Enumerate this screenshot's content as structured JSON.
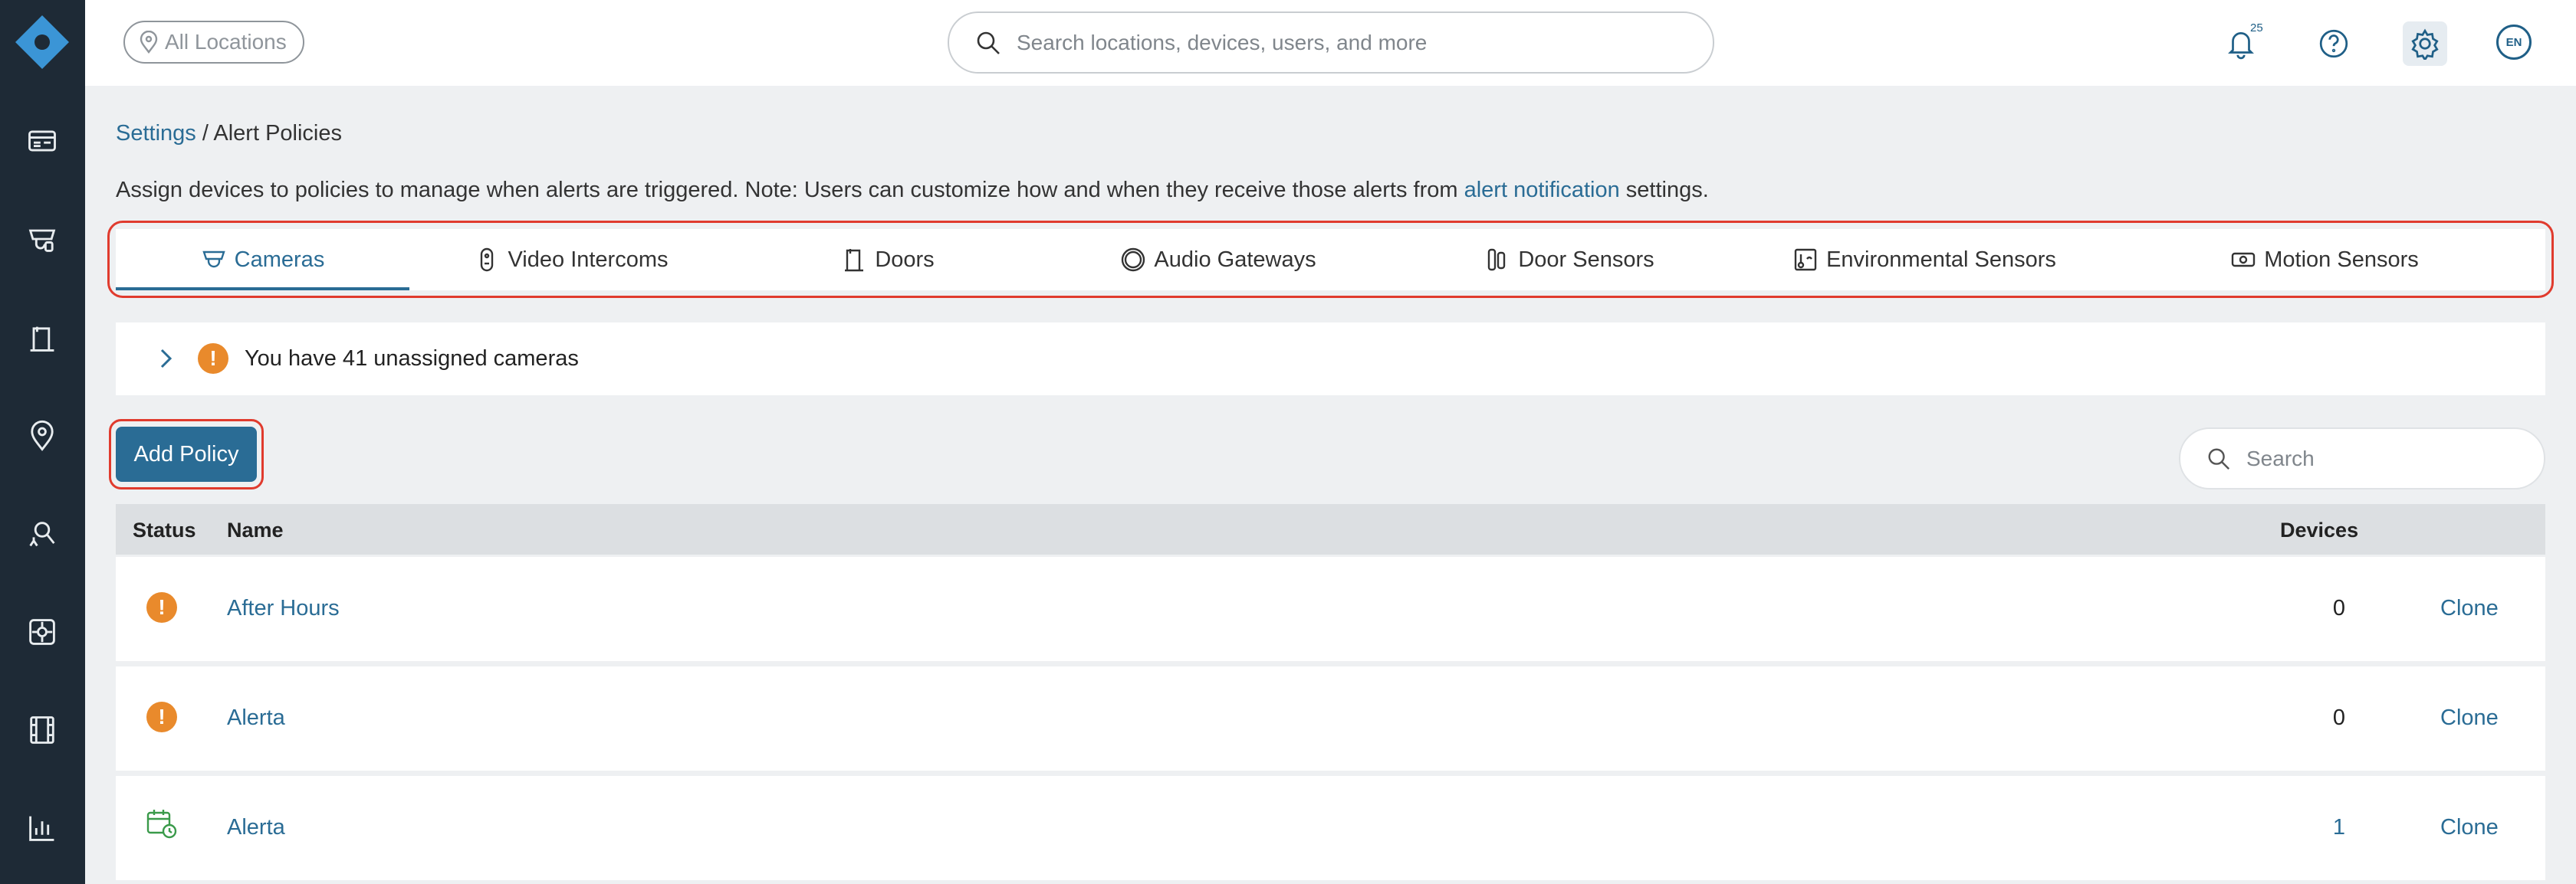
{
  "colors": {
    "accent": "#2a6c95",
    "warning": "#e98a2c",
    "highlight": "#e03b2e",
    "sidebar": "#1e2a36",
    "scheduled": "#3a9a4a"
  },
  "sidebar": {
    "items": [
      {
        "icon": "dashboard-icon"
      },
      {
        "icon": "camera-icon"
      },
      {
        "icon": "door-icon"
      },
      {
        "icon": "location-pin-icon"
      },
      {
        "icon": "people-search-icon"
      },
      {
        "icon": "integrations-icon"
      },
      {
        "icon": "video-film-icon"
      },
      {
        "icon": "reports-chart-icon"
      }
    ]
  },
  "header": {
    "location_filter": "All Locations",
    "search_placeholder": "Search locations, devices, users, and more",
    "notification_count": "25",
    "language": "EN"
  },
  "breadcrumb": {
    "parent": "Settings",
    "separator": "/",
    "current": "Alert Policies"
  },
  "description": {
    "before": "Assign devices to policies to manage when alerts are triggered. Note: Users can customize how and when they receive those alerts from",
    "link": "alert notification",
    "after": "settings."
  },
  "tabs": [
    {
      "label": "Cameras",
      "icon": "camera-icon",
      "active": true
    },
    {
      "label": "Video Intercoms",
      "icon": "intercom-icon"
    },
    {
      "label": "Doors",
      "icon": "door-icon"
    },
    {
      "label": "Audio Gateways",
      "icon": "audio-gateway-icon"
    },
    {
      "label": "Door Sensors",
      "icon": "door-sensor-icon"
    },
    {
      "label": "Environmental Sensors",
      "icon": "environmental-sensor-icon"
    },
    {
      "label": "Motion Sensors",
      "icon": "motion-sensor-icon"
    }
  ],
  "banner": {
    "text": "You have 41 unassigned cameras"
  },
  "actions": {
    "add_policy": "Add Policy",
    "search_placeholder": "Search"
  },
  "table": {
    "columns": {
      "status": "Status",
      "name": "Name",
      "devices": "Devices"
    },
    "rows": [
      {
        "status": "warning",
        "name": "After Hours",
        "devices": "0",
        "action": "Clone"
      },
      {
        "status": "warning",
        "name": "Alerta",
        "devices": "0",
        "action": "Clone"
      },
      {
        "status": "scheduled",
        "name": "Alerta",
        "devices": "1",
        "action": "Clone"
      }
    ]
  }
}
